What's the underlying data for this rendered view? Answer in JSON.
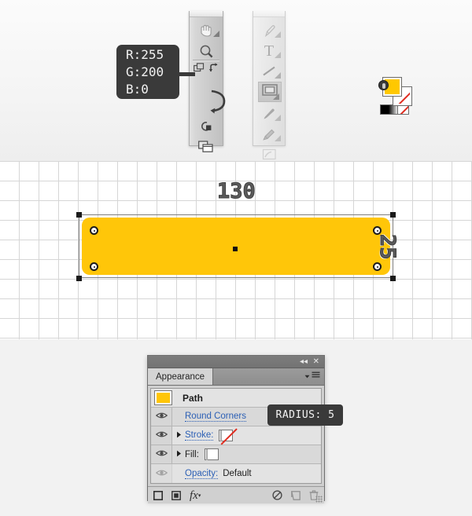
{
  "tooltips": {
    "color_readout": {
      "r": "R:255",
      "g": "G:200",
      "b": "B:0"
    },
    "radius": "RADIUS: 5"
  },
  "toolbars": {
    "left": {
      "name": "tools-panel-left",
      "tools": [
        {
          "id": "hand-tool",
          "icon": "hand-icon"
        },
        {
          "id": "zoom-tool",
          "icon": "magnifier-icon"
        },
        {
          "id": "artboard-tool",
          "icon": "artboard-icon"
        },
        {
          "id": "swap-fill-stroke",
          "icon": "swap-arrow-icon"
        },
        {
          "id": "fill-swatch",
          "icon": "fill-swatch-icon",
          "color": "#FFC800"
        },
        {
          "id": "stroke-swatch",
          "icon": "stroke-none-icon",
          "color": "#FFFFFF"
        },
        {
          "id": "gradient-swatch",
          "icon": "gradient-icon"
        },
        {
          "id": "none-swatch",
          "icon": "none-swatch-icon"
        },
        {
          "id": "drawing-mode",
          "icon": "draw-normal-icon"
        },
        {
          "id": "screen-mode",
          "icon": "screen-mode-icon"
        }
      ]
    },
    "right": {
      "name": "tools-panel-right",
      "tools": [
        {
          "id": "pen-tool",
          "icon": "pen-icon",
          "selected": false
        },
        {
          "id": "type-tool",
          "icon": "type-T-icon",
          "selected": false
        },
        {
          "id": "line-segment-tool",
          "icon": "line-icon",
          "selected": false
        },
        {
          "id": "rectangle-tool",
          "icon": "rectangle-icon",
          "selected": true
        },
        {
          "id": "paintbrush-tool",
          "icon": "paintbrush-icon",
          "selected": false
        },
        {
          "id": "pencil-tool",
          "icon": "pencil-icon",
          "selected": false
        },
        {
          "id": "blob-brush-tool",
          "icon": "blob-brush-icon",
          "selected": false
        }
      ]
    }
  },
  "canvas": {
    "grid_size_px": 25,
    "shape": {
      "name": "rounded-rectangle",
      "fill": "#FFC609",
      "width_label": "130",
      "height_label": "25",
      "corner_radius": 5
    }
  },
  "panel": {
    "title": "Appearance",
    "controls": {
      "collapse": "◂◂",
      "close": "✕"
    },
    "rows": [
      {
        "name": "path-row",
        "label": "Path",
        "kind": "header",
        "thumb": "#FFC609"
      },
      {
        "name": "round-corners-row",
        "label": "Round Corners",
        "kind": "effect",
        "link": true
      },
      {
        "name": "stroke-row",
        "label": "Stroke:",
        "kind": "stroke",
        "link": true,
        "swatch": "none"
      },
      {
        "name": "fill-row",
        "label": "Fill:",
        "kind": "fill",
        "link": true,
        "swatch": "#FFC609"
      },
      {
        "name": "opacity-row",
        "label": "Opacity:",
        "value": "Default",
        "kind": "opacity",
        "link": true,
        "dim": true
      }
    ],
    "footer": [
      {
        "name": "add-new-stroke-button",
        "icon": "square-outline-icon"
      },
      {
        "name": "add-new-fill-button",
        "icon": "square-filled-icon"
      },
      {
        "name": "add-new-effect-button",
        "icon": "fx-icon"
      },
      {
        "name": "clear-appearance-button",
        "icon": "no-symbol-icon"
      },
      {
        "name": "duplicate-item-button",
        "icon": "duplicate-icon"
      },
      {
        "name": "delete-item-button",
        "icon": "trash-icon"
      }
    ]
  },
  "colors": {
    "accent_yellow": "#FFC609",
    "tooltip_bg": "#3A3A3A",
    "link_blue": "#2B5FB5",
    "grid_line": "#D6D6D6"
  }
}
